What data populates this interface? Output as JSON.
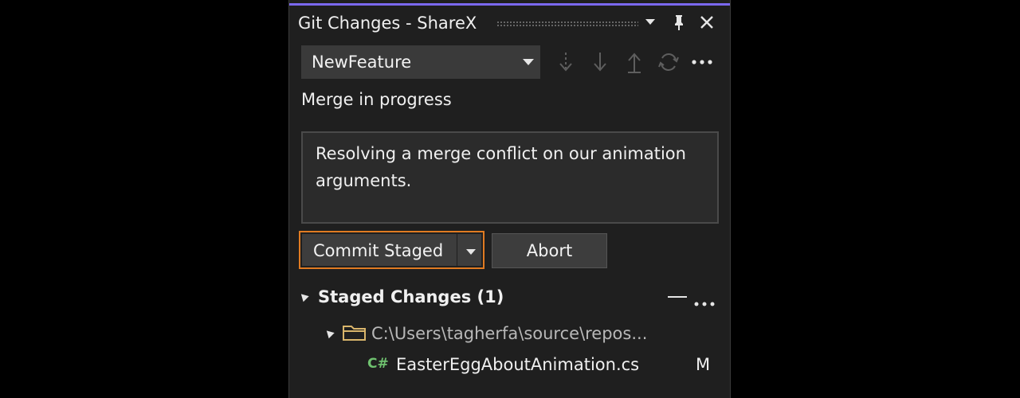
{
  "window": {
    "title": "Git Changes - ShareX"
  },
  "branch": {
    "name": "NewFeature"
  },
  "status": {
    "text": "Merge in progress"
  },
  "commit_message": {
    "text": "Resolving a merge conflict on our animation arguments."
  },
  "buttons": {
    "commit_label": "Commit Staged",
    "abort_label": "Abort"
  },
  "staged": {
    "title": "Staged Changes (1)",
    "folder_path": "C:\\Users\\tagherfa\\source\\repos...",
    "files": [
      {
        "icon": "csharp-file-icon",
        "icon_text": "C#",
        "name": "EasterEggAboutAnimation.cs",
        "status": "M"
      }
    ]
  },
  "colors": {
    "accent": "#7b68ee",
    "focus_border": "#e07b22",
    "panel_bg": "#1f1f1f",
    "csharp_icon": "#6fc16f"
  },
  "icons": [
    "dropdown-icon",
    "pin-icon",
    "close-icon",
    "fetch-icon",
    "pull-icon",
    "push-icon",
    "sync-icon",
    "more-icon",
    "collapse-icon",
    "minimize-icon",
    "folder-icon"
  ]
}
